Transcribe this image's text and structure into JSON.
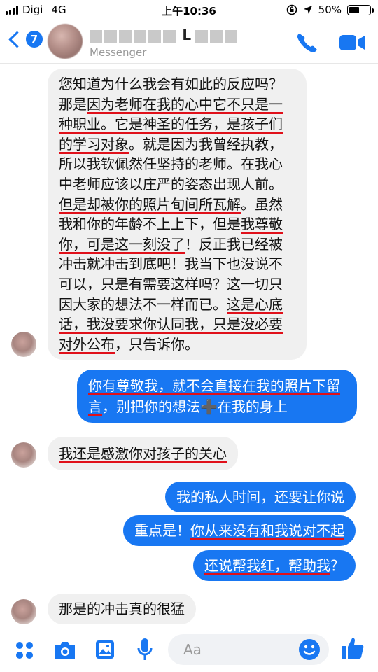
{
  "status": {
    "carrier": "Digi",
    "network": "4G",
    "time": "上午10:36",
    "battery": "50%",
    "battery_level": 0.5
  },
  "header": {
    "back_badge": "7",
    "contact_name_visible": "L",
    "subtitle": "Messenger",
    "accent": "#1877f2"
  },
  "messages": [
    {
      "direction": "incoming",
      "segments": [
        {
          "text": "您知道为什么我会有如此的反应吗？那是",
          "u": false
        },
        {
          "text": "因为老师在我的心中它不只是一种职业。它是神圣的任务，是孩子们的学习对象",
          "u": true
        },
        {
          "text": "。就是因为我曾经执教，所以我钦佩然任坚持的老师。在我心中老师应该以庄严的姿态出现人前。",
          "u": false
        },
        {
          "text": "但是却被你的照片旬间所瓦解",
          "u": true
        },
        {
          "text": "。虽然我和你的年龄不上上下，但是",
          "u": false
        },
        {
          "text": "我尊敬你，可是这一刻没了",
          "u": true
        },
        {
          "text": "！反正我已经被冲击就冲击到底吧！我当下也没说不可以，只是有需要这样吗？这一切只因大家的想法不一样而已。",
          "u": false
        },
        {
          "text": "这是心底话，我没要求你认同我，只是没必要对外公布",
          "u": true
        },
        {
          "text": "，只告诉你。",
          "u": false
        }
      ]
    },
    {
      "direction": "outgoing",
      "segments": [
        {
          "text": "你有尊敬我，就不会直接在我的照片下留言",
          "u": true
        },
        {
          "text": "，别把你的想法➕在我的身上",
          "u": false
        }
      ]
    },
    {
      "direction": "incoming",
      "segments": [
        {
          "text": "我还是感激你对孩子的关心",
          "u": true
        }
      ]
    },
    {
      "direction": "outgoing",
      "segments": [
        {
          "text": "我的私人时间，还要让你说",
          "u": false
        }
      ]
    },
    {
      "direction": "outgoing",
      "segments": [
        {
          "text": "重点是！",
          "u": false
        },
        {
          "text": "你从来没有和我说对不起",
          "u": true
        }
      ]
    },
    {
      "direction": "outgoing",
      "segments": [
        {
          "text": "还说帮我红，帮助我",
          "u": true
        },
        {
          "text": "？",
          "u": false
        }
      ]
    },
    {
      "direction": "incoming",
      "segments": [
        {
          "text": "那是的冲击真的很猛",
          "u": false
        }
      ]
    }
  ],
  "composer": {
    "placeholder": "Aa",
    "icons": [
      "apps-icon",
      "camera-icon",
      "gallery-icon",
      "microphone-icon",
      "emoji-icon",
      "thumbs-up-icon"
    ]
  }
}
